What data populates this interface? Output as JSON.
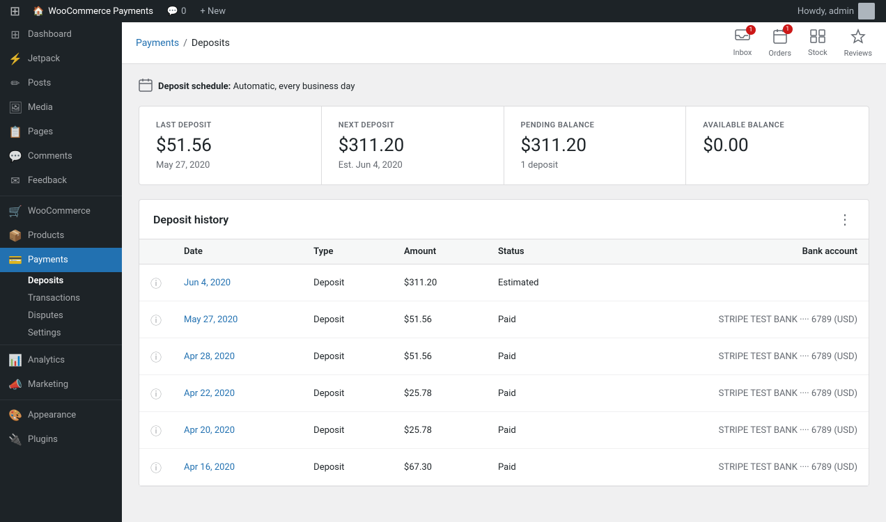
{
  "admin_bar": {
    "logo": "W",
    "site_name": "WooCommerce Payments",
    "comments_label": "Comments",
    "comments_count": "0",
    "new_label": "+ New",
    "howdy": "Howdy, admin"
  },
  "sidebar": {
    "items": [
      {
        "id": "dashboard",
        "label": "Dashboard",
        "icon": "⊞"
      },
      {
        "id": "jetpack",
        "label": "Jetpack",
        "icon": "⚡"
      },
      {
        "id": "posts",
        "label": "Posts",
        "icon": "📄"
      },
      {
        "id": "media",
        "label": "Media",
        "icon": "🖼"
      },
      {
        "id": "pages",
        "label": "Pages",
        "icon": "📋"
      },
      {
        "id": "comments",
        "label": "Comments",
        "icon": "💬"
      },
      {
        "id": "feedback",
        "label": "Feedback",
        "icon": "✉"
      },
      {
        "id": "woocommerce",
        "label": "WooCommerce",
        "icon": "🛒"
      },
      {
        "id": "products",
        "label": "Products",
        "icon": "📦"
      },
      {
        "id": "payments",
        "label": "Payments",
        "icon": "💳",
        "active": true
      }
    ],
    "payments_sub": [
      {
        "id": "deposits",
        "label": "Deposits",
        "active": true
      },
      {
        "id": "transactions",
        "label": "Transactions"
      },
      {
        "id": "disputes",
        "label": "Disputes"
      },
      {
        "id": "settings",
        "label": "Settings"
      }
    ],
    "bottom_items": [
      {
        "id": "analytics",
        "label": "Analytics",
        "icon": "📊"
      },
      {
        "id": "marketing",
        "label": "Marketing",
        "icon": "📣"
      },
      {
        "id": "appearance",
        "label": "Appearance",
        "icon": "🎨"
      },
      {
        "id": "plugins",
        "label": "Plugins",
        "icon": "🔌"
      }
    ]
  },
  "toolbar": {
    "inbox_label": "Inbox",
    "orders_label": "Orders",
    "stock_label": "Stock",
    "reviews_label": "Reviews",
    "inbox_badge": "",
    "orders_badge": "1"
  },
  "breadcrumb": {
    "parent": "Payments",
    "separator": "/",
    "current": "Deposits"
  },
  "deposit_schedule": {
    "icon": "📅",
    "label": "Deposit schedule:",
    "value": "Automatic, every business day"
  },
  "stats": [
    {
      "label": "LAST DEPOSIT",
      "value": "$51.56",
      "sub": "May 27, 2020"
    },
    {
      "label": "NEXT DEPOSIT",
      "value": "$311.20",
      "sub": "Est. Jun 4, 2020"
    },
    {
      "label": "PENDING BALANCE",
      "value": "$311.20",
      "sub": "1 deposit"
    },
    {
      "label": "AVAILABLE BALANCE",
      "value": "$0.00",
      "sub": ""
    }
  ],
  "history": {
    "title": "Deposit history",
    "menu_icon": "⋮",
    "columns": [
      "",
      "Date",
      "Type",
      "Amount",
      "Status",
      "Bank account"
    ],
    "rows": [
      {
        "date": "Jun 4, 2020",
        "type": "Deposit",
        "amount": "$311.20",
        "status": "Estimated",
        "bank": ""
      },
      {
        "date": "May 27, 2020",
        "type": "Deposit",
        "amount": "$51.56",
        "status": "Paid",
        "bank": "STRIPE TEST BANK ···· 6789 (USD)"
      },
      {
        "date": "Apr 28, 2020",
        "type": "Deposit",
        "amount": "$51.56",
        "status": "Paid",
        "bank": "STRIPE TEST BANK ···· 6789 (USD)"
      },
      {
        "date": "Apr 22, 2020",
        "type": "Deposit",
        "amount": "$25.78",
        "status": "Paid",
        "bank": "STRIPE TEST BANK ···· 6789 (USD)"
      },
      {
        "date": "Apr 20, 2020",
        "type": "Deposit",
        "amount": "$25.78",
        "status": "Paid",
        "bank": "STRIPE TEST BANK ···· 6789 (USD)"
      },
      {
        "date": "Apr 16, 2020",
        "type": "Deposit",
        "amount": "$67.30",
        "status": "Paid",
        "bank": "STRIPE TEST BANK ···· 6789 (USD)"
      }
    ]
  }
}
